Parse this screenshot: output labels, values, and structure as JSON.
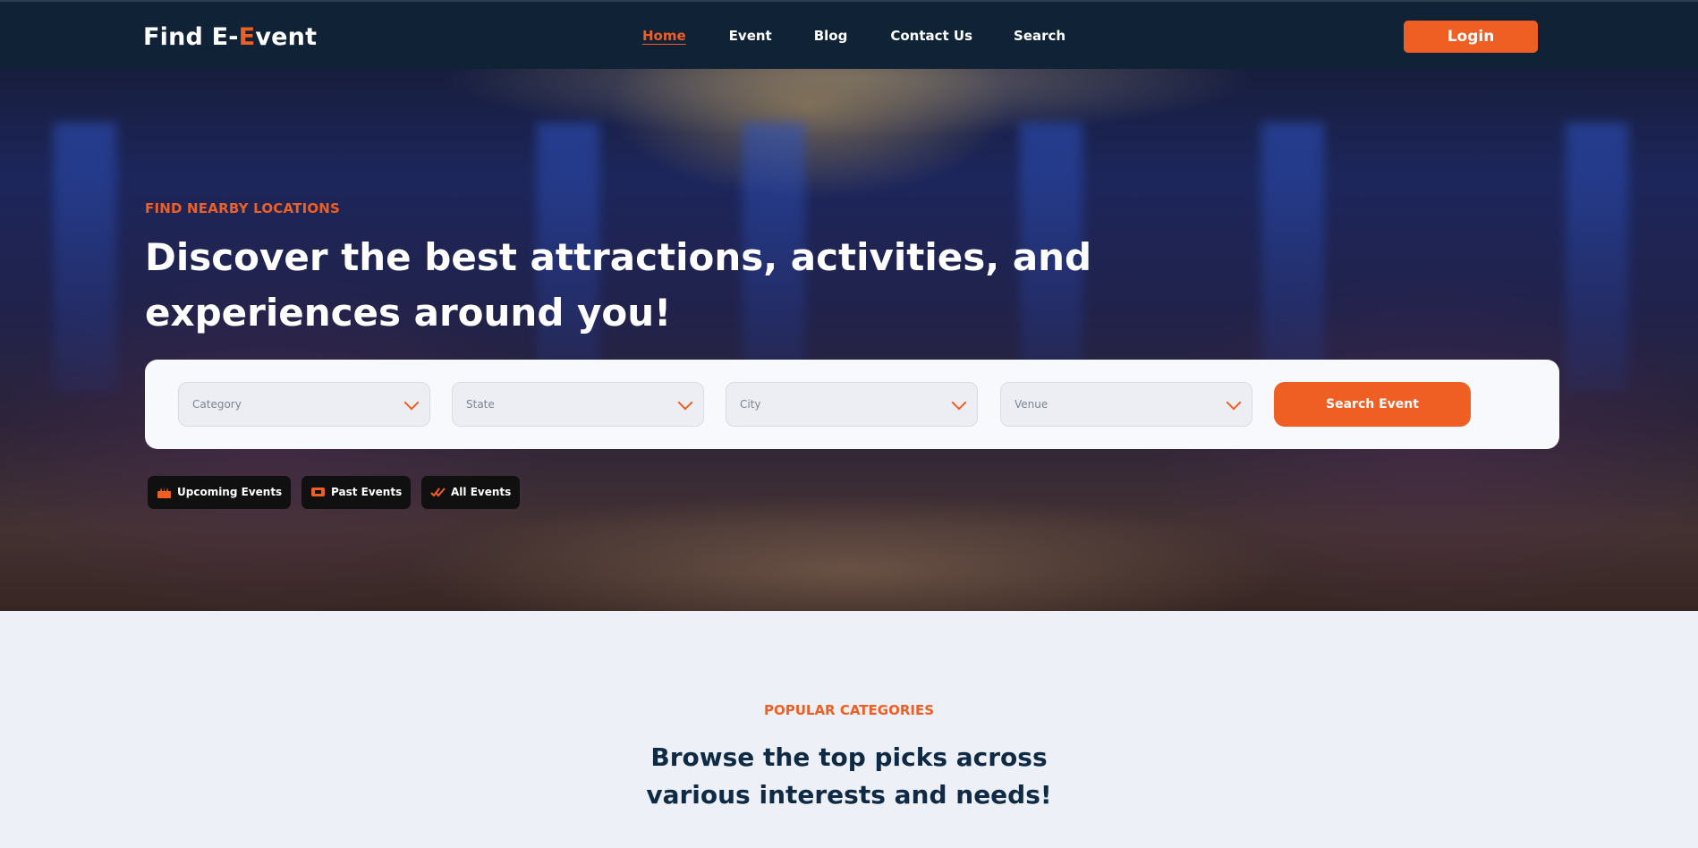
{
  "header": {
    "logo_prefix": "Find E-",
    "logo_accent": "E",
    "logo_suffix": "vent",
    "nav": [
      {
        "label": "Home",
        "active": true
      },
      {
        "label": "Event",
        "active": false
      },
      {
        "label": "Blog",
        "active": false
      },
      {
        "label": "Contact Us",
        "active": false
      },
      {
        "label": "Search",
        "active": false
      }
    ],
    "login_label": "Login"
  },
  "hero": {
    "eyebrow": "FIND NEARBY LOCATIONS",
    "headline": "Discover the best attractions, activities, and experiences around you!",
    "filters": {
      "category": "Category",
      "state": "State",
      "city": "City",
      "venue": "Venue"
    },
    "search_label": "Search Event",
    "pills": {
      "upcoming": "Upcoming Events",
      "past": "Past Events",
      "all": "All Events"
    }
  },
  "categories": {
    "eyebrow": "POPULAR CATEGORIES",
    "title": "Browse the top picks across various interests and needs!"
  },
  "colors": {
    "accent": "#ef5f23",
    "navbar": "#102235",
    "page_bg": "#edf0f6"
  },
  "icons": {
    "upcoming": "calendar-flame-icon",
    "past": "ticket-icon",
    "all": "double-check-icon",
    "select": "chevron-down-icon"
  }
}
